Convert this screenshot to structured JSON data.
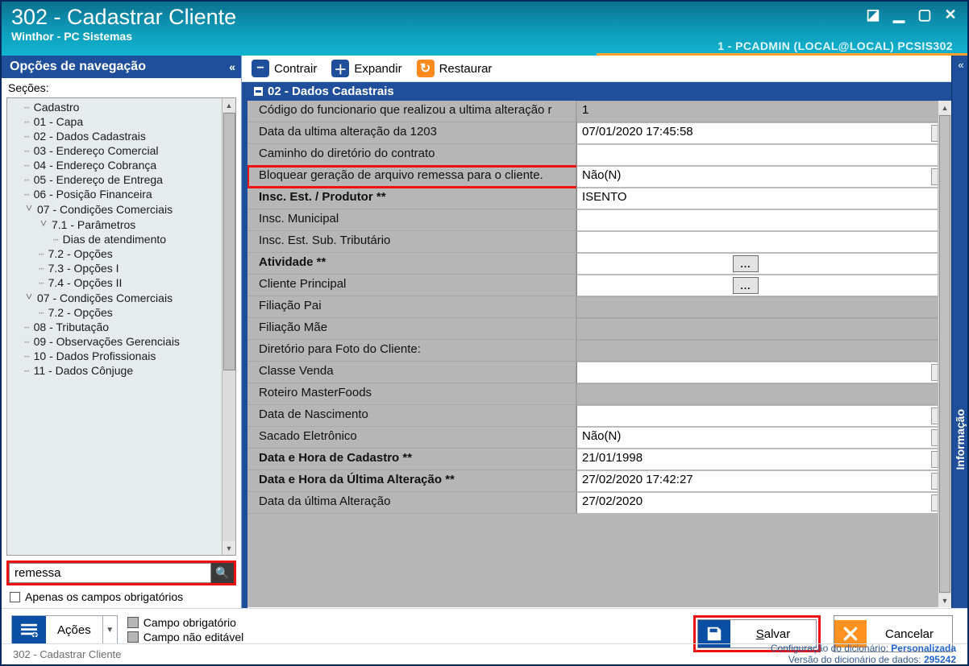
{
  "window": {
    "title": "302 - Cadastrar Cliente",
    "subtitle": "Winthor - PC Sistemas",
    "session": "1 - PCADMIN (LOCAL@LOCAL)   PCSIS302"
  },
  "nav": {
    "header": "Opções de navegação",
    "sections_label": "Seções:",
    "tree": [
      {
        "label": "Cadastro",
        "depth": 1
      },
      {
        "label": "01 - Capa",
        "depth": 1
      },
      {
        "label": "02 - Dados Cadastrais",
        "depth": 1
      },
      {
        "label": "03 - Endereço Comercial",
        "depth": 1
      },
      {
        "label": "04 - Endereço Cobrança",
        "depth": 1
      },
      {
        "label": "05 - Endereço de Entrega",
        "depth": 1
      },
      {
        "label": "06 - Posição Financeira",
        "depth": 1
      },
      {
        "label": "07 - Condições Comerciais",
        "depth": 1,
        "exp": "v"
      },
      {
        "label": "7.1 - Parâmetros",
        "depth": 2,
        "exp": "v"
      },
      {
        "label": "Dias de atendimento",
        "depth": 3
      },
      {
        "label": "7.2 - Opções",
        "depth": 2
      },
      {
        "label": "7.3 - Opções I",
        "depth": 2
      },
      {
        "label": "7.4 - Opções II",
        "depth": 2
      },
      {
        "label": "07 - Condições Comerciais",
        "depth": 1,
        "exp": "v"
      },
      {
        "label": "7.2 - Opções",
        "depth": 2
      },
      {
        "label": "08 - Tributação",
        "depth": 1
      },
      {
        "label": "09 - Observações Gerenciais",
        "depth": 1
      },
      {
        "label": "10 - Dados Profissionais",
        "depth": 1
      },
      {
        "label": "11 - Dados Cônjuge",
        "depth": 1
      }
    ],
    "search_value": "remessa",
    "only_required": "Apenas os campos obrigatórios"
  },
  "toolbar": {
    "contrair": "Contrair",
    "expandir": "Expandir",
    "restaurar": "Restaurar"
  },
  "section": {
    "title": "02 - Dados Cadastrais",
    "rows": [
      {
        "label": "Código do funcionario que realizou a ultima alteração r",
        "value": "1",
        "grey": true
      },
      {
        "label": "Data da ultima alteração da 1203",
        "value": "07/01/2020 17:45:58",
        "combo": true
      },
      {
        "label": "Caminho do diretório do contrato",
        "value": ""
      },
      {
        "label": "Bloquear geração de arquivo remessa para o cliente.",
        "value": "Não(N)",
        "combo": true,
        "highlight": true
      },
      {
        "label": "Insc. Est. / Produtor **",
        "value": "ISENTO",
        "bold": true
      },
      {
        "label": "Insc. Municipal",
        "value": ""
      },
      {
        "label": "Insc. Est. Sub. Tributário",
        "value": ""
      },
      {
        "label": "Atividade **",
        "value": "",
        "bold": true,
        "ell": true
      },
      {
        "label": "Cliente Principal",
        "value": "",
        "ell": true
      },
      {
        "label": "Filiação Pai",
        "value": "",
        "grey": true
      },
      {
        "label": "Filiação Mãe",
        "value": "",
        "grey": true
      },
      {
        "label": "Diretório para Foto do Cliente:",
        "value": "",
        "grey": true
      },
      {
        "label": "Classe Venda",
        "value": "",
        "combo": true
      },
      {
        "label": "Roteiro MasterFoods",
        "value": "",
        "grey": true
      },
      {
        "label": "Data de Nascimento",
        "value": "",
        "combo": true
      },
      {
        "label": "Sacado Eletrônico",
        "value": "Não(N)",
        "combo": true
      },
      {
        "label": "Data e Hora de Cadastro **",
        "value": "21/01/1998",
        "bold": true,
        "combo": true
      },
      {
        "label": "Data e Hora da Última Alteração **",
        "value": "27/02/2020 17:42:27",
        "bold": true,
        "combo": true
      },
      {
        "label": "Data da última Alteração",
        "value": "27/02/2020",
        "combo": true
      }
    ]
  },
  "info_tab": "Informação",
  "footer": {
    "acoes": "Ações",
    "legend_required": "Campo obrigatório",
    "legend_readonly": "Campo não editável",
    "salvar": "Salvar",
    "cancelar": "Cancelar",
    "status_left": "302 - Cadastrar Cliente",
    "status_conf_lbl": "Configuração do dicionário:",
    "status_conf_val": "Personalizada",
    "status_ver_lbl": "Versão do dicionário de dados:",
    "status_ver_val": "295242"
  }
}
